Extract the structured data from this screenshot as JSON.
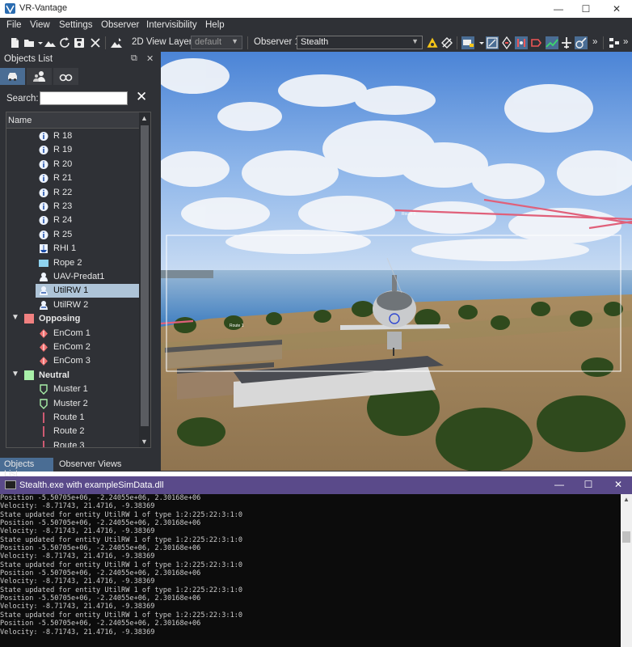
{
  "window": {
    "title": "VR-Vantage",
    "minimize": "—",
    "maximize": "☐",
    "close": "✕"
  },
  "menu": [
    "File",
    "View",
    "Settings",
    "Observer",
    "Intervisibility",
    "Help"
  ],
  "toolbar": {
    "view_layer_label": "2D View Layer:",
    "view_layer_value": "default",
    "observer_label": "Observer 1",
    "observer_value": "Stealth",
    "overflow": "»"
  },
  "objects_dock": {
    "title": "Objects List",
    "float_icon": "⧉",
    "close_icon": "✕",
    "search_label": "Search:",
    "search_value": "",
    "clear_icon": "✕",
    "column_header": "Name",
    "items": [
      {
        "label": "R 18",
        "icon": "info-circle-icon",
        "indent": 2
      },
      {
        "label": "R 19",
        "icon": "info-circle-icon",
        "indent": 2
      },
      {
        "label": "R 20",
        "icon": "info-circle-icon",
        "indent": 2
      },
      {
        "label": "R 21",
        "icon": "info-circle-icon",
        "indent": 2
      },
      {
        "label": "R 22",
        "icon": "info-circle-icon",
        "indent": 2
      },
      {
        "label": "R 23",
        "icon": "info-circle-icon",
        "indent": 2
      },
      {
        "label": "R 24",
        "icon": "info-circle-icon",
        "indent": 2
      },
      {
        "label": "R 25",
        "icon": "info-circle-icon",
        "indent": 2
      },
      {
        "label": "RHI 1",
        "icon": "boat-icon",
        "indent": 2
      },
      {
        "label": "Rope 2",
        "icon": "rope-icon",
        "indent": 2
      },
      {
        "label": "UAV-Predat1",
        "icon": "uav-icon",
        "indent": 2
      },
      {
        "label": "UtilRW 1",
        "icon": "helicopter-icon",
        "indent": 2,
        "selected": true
      },
      {
        "label": "UtilRW 2",
        "icon": "helicopter-icon",
        "indent": 2
      },
      {
        "label": "Opposing",
        "group": true,
        "swatch": "#f08080"
      },
      {
        "label": "EnCom 1",
        "icon": "enemy-diamond-icon",
        "indent": 2
      },
      {
        "label": "EnCom 2",
        "icon": "enemy-diamond-icon",
        "indent": 2
      },
      {
        "label": "EnCom 3",
        "icon": "enemy-diamond-icon",
        "indent": 2
      },
      {
        "label": "Neutral",
        "group": true,
        "swatch": "#a8f0a8"
      },
      {
        "label": "Muster 1",
        "icon": "muster-icon",
        "indent": 2
      },
      {
        "label": "Muster 2",
        "icon": "muster-icon",
        "indent": 2
      },
      {
        "label": "Route 1",
        "icon": "route-line-icon",
        "indent": 2
      },
      {
        "label": "Route 2",
        "icon": "route-line-icon",
        "indent": 2
      },
      {
        "label": "Route 3",
        "icon": "route-line-icon",
        "indent": 2
      }
    ],
    "bottom_tabs": [
      "Objects List",
      "Observer Views"
    ]
  },
  "view": {
    "labels": [
      "Route 3",
      "Route 1"
    ]
  },
  "console": {
    "title": "Stealth.exe with exampleSimData.dll",
    "minimize": "—",
    "maximize": "☐",
    "close": "✕",
    "lines": [
      "Position -5.50705e+06, -2.24055e+06, 2.30168e+06",
      "Velocity: -8.71743, 21.4716, -9.38369",
      "State updated for entity UtilRW 1 of type 1:2:225:22:3:1:0",
      "Position -5.50705e+06, -2.24055e+06, 2.30168e+06",
      "Velocity: -8.71743, 21.4716, -9.38369",
      "State updated for entity UtilRW 1 of type 1:2:225:22:3:1:0",
      "Position -5.50705e+06, -2.24055e+06, 2.30168e+06",
      "Velocity: -8.71743, 21.4716, -9.38369",
      "State updated for entity UtilRW 1 of type 1:2:225:22:3:1:0",
      "Position -5.50705e+06, -2.24055e+06, 2.30168e+06",
      "Velocity: -8.71743, 21.4716, -9.38369",
      "State updated for entity UtilRW 1 of type 1:2:225:22:3:1:0",
      "Position -5.50705e+06, -2.24055e+06, 2.30168e+06",
      "Velocity: -8.71743, 21.4716, -9.38369",
      "State updated for entity UtilRW 1 of type 1:2:225:22:3:1:0",
      "Position -5.50705e+06, -2.24055e+06, 2.30168e+06",
      "Velocity: -8.71743, 21.4716, -9.38369"
    ]
  }
}
